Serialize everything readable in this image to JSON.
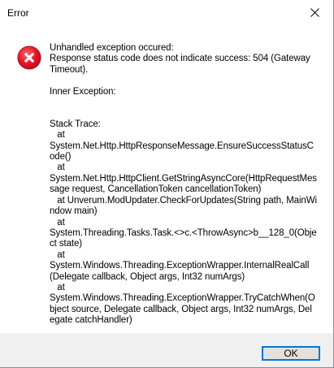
{
  "window": {
    "title": "Error",
    "close_icon": "close-icon"
  },
  "dialog": {
    "icon": "error-icon",
    "icon_color": "#e81123",
    "message": "Unhandled exception occured:\nResponse status code does not indicate success: 504 (Gateway Timeout).\n\nInner Exception:\n\n\nStack Trace:\n   at\nSystem.Net.Http.HttpResponseMessage.EnsureSuccessStatusCode()\n   at\nSystem.Net.Http.HttpClient.GetStringAsyncCore(HttpRequestMessage request, CancellationToken cancellationToken)\n   at Unverum.ModUpdater.CheckForUpdates(String path, MainWindow main)\n   at\nSystem.Threading.Tasks.Task.<>c.<ThrowAsync>b__128_0(Object state)\n   at\nSystem.Windows.Threading.ExceptionWrapper.InternalRealCall(Delegate callback, Object args, Int32 numArgs)\n   at\nSystem.Windows.Threading.ExceptionWrapper.TryCatchWhen(Object source, Delegate callback, Object args, Int32 numArgs, Delegate catchHandler)"
  },
  "buttons": {
    "ok_label": "OK",
    "accent": "#0078d7"
  }
}
